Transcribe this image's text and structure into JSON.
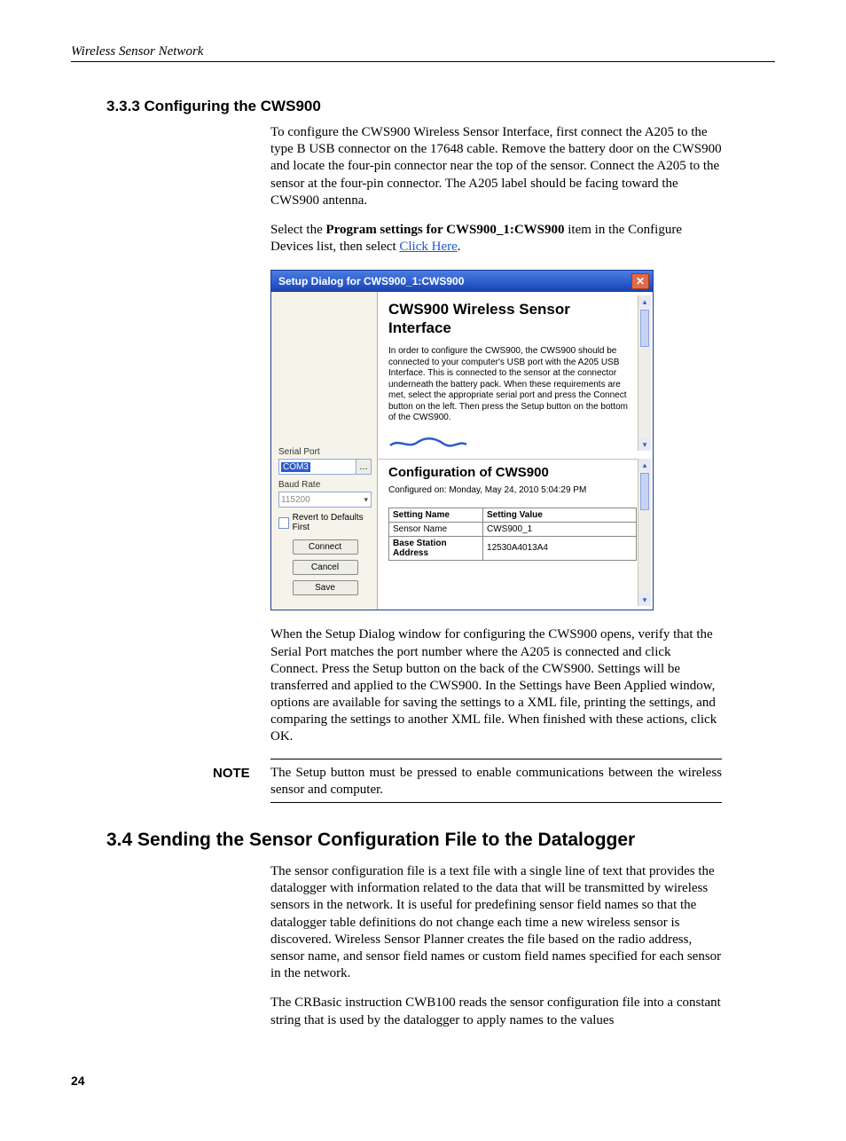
{
  "header": {
    "running_title": "Wireless Sensor Network"
  },
  "section333": {
    "heading": "3.3.3  Configuring the CWS900",
    "p1": "To configure the CWS900 Wireless Sensor Interface, first connect the A205 to the type B USB connector on the 17648 cable.  Remove the battery door on the CWS900 and locate the four-pin connector near the top of the sensor.  Connect the A205 to the sensor at the four-pin connector.  The A205 label should be facing toward the CWS900 antenna.",
    "p2_pre": "Select the ",
    "p2_bold": "Program settings for CWS900_1:CWS900",
    "p2_mid": " item in the Configure Devices list, then select ",
    "p2_link": "Click Here",
    "p2_post": ".",
    "p3": "When the Setup Dialog window for configuring the CWS900 opens, verify that the Serial Port matches the port number where the A205 is connected and click Connect.  Press the Setup button on the back of the CWS900.  Settings will be transferred and applied to the CWS900.  In the Settings have Been Applied window, options are available for saving the settings to a XML file, printing the settings, and comparing the settings to another XML file.  When finished with these actions, click OK."
  },
  "note": {
    "label": "NOTE",
    "text": "The Setup button must be pressed to enable communications between the wireless sensor and computer."
  },
  "section34": {
    "heading": "3.4  Sending the Sensor Configuration File to the Datalogger",
    "p1": "The sensor configuration file is a text file with a single line of text that provides the datalogger with information related to the data that will be transmitted by wireless sensors in the network.  It is useful for predefining sensor field names so that the datalogger table definitions do not change each time a new wireless sensor is discovered.  Wireless Sensor Planner creates the file based on the radio address, sensor name, and sensor field names or custom field names specified for each sensor in the network.",
    "p2": "The CRBasic instruction CWB100 reads the sensor configuration file into a constant string that is used by the datalogger to apply names to the values"
  },
  "page_number": "24",
  "dialog": {
    "title": "Setup Dialog for CWS900_1:CWS900",
    "left": {
      "serial_port_label": "Serial Port",
      "serial_port_value": "COM3",
      "baud_label": "Baud Rate",
      "baud_value": "115200",
      "revert_label": "Revert to Defaults First",
      "connect": "Connect",
      "cancel": "Cancel",
      "save": "Save"
    },
    "right": {
      "title": "CWS900 Wireless Sensor Interface",
      "desc": "In order to configure the CWS900, the CWS900 should be connected to your computer's USB port with the A205 USB Interface. This is connected to the sensor at the connector underneath the battery pack. When these requirements are met, select the appropriate serial port and press the Connect button on the left. Then press the Setup button on the bottom of the CWS900.",
      "subtitle": "Configuration of CWS900",
      "configured_on": "Configured on: Monday, May 24, 2010 5:04:29 PM",
      "table": {
        "h1": "Setting Name",
        "h2": "Setting Value",
        "rows": [
          {
            "name": "Sensor Name",
            "value": "CWS900_1"
          },
          {
            "name": "Base Station Address",
            "value": "12530A4013A4"
          }
        ]
      }
    }
  }
}
